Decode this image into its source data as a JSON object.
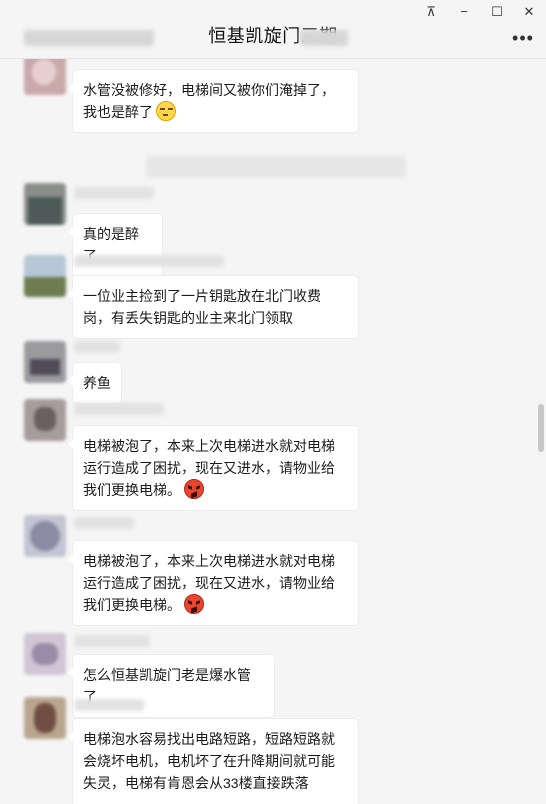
{
  "window": {
    "pin_icon": "pin-icon",
    "pin_glyph": "⊼",
    "minimize_glyph": "−",
    "maximize_glyph": "☐",
    "close_glyph": "✕"
  },
  "header": {
    "title": "恒基凯旋门三期",
    "more_glyph": "•••"
  },
  "messages": [
    {
      "text": "水管没被修好，电梯间又被你们淹掉了，我也是醉了",
      "emoji": "annoyed-face"
    },
    {
      "text": "真的是醉了"
    },
    {
      "text": "一位业主捡到了一片钥匙放在北门收费岗，有丢失钥匙的业主来北门领取"
    },
    {
      "text": "养鱼"
    },
    {
      "text": "电梯被泡了，本来上次电梯进水就对电梯运行造成了困扰，现在又进水，请物业给我们更换电梯。",
      "emoji": "angry-face"
    },
    {
      "text": "电梯被泡了，本来上次电梯进水就对电梯运行造成了困扰，现在又进水，请物业给我们更换电梯。",
      "emoji": "angry-face"
    },
    {
      "text": "怎么恒基凯旋门老是爆水管了"
    },
    {
      "text": "电梯泡水容易找出电路短路，短路短路就会烧坏电机，电机坏了在升降期间就可能失灵，电梯有肯恩会从33楼直接跌落~~~~~"
    }
  ],
  "colors": {
    "background": "#f5f5f5",
    "bubble": "#ffffff",
    "text": "#1a1a1a"
  }
}
